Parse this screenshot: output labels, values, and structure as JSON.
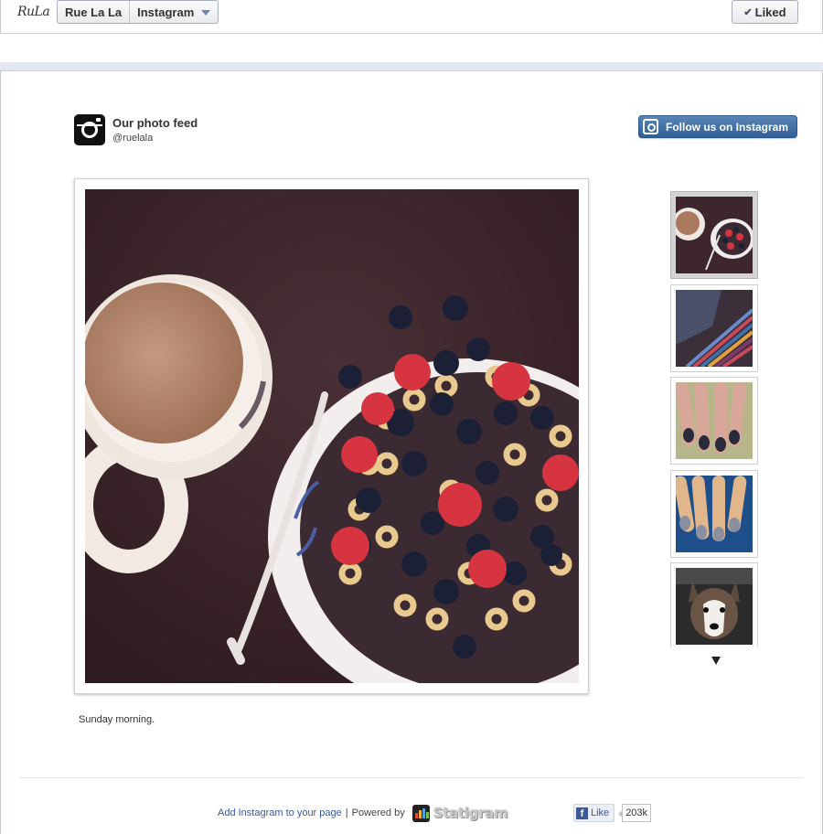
{
  "header": {
    "brand_logo_text": "Rue La La",
    "breadcrumb": {
      "page": "Rue La La",
      "app": "Instagram"
    },
    "liked_label": "Liked"
  },
  "feed": {
    "title": "Our photo feed",
    "handle": "@ruelala",
    "follow_label": "Follow us on Instagram"
  },
  "main_photo": {
    "caption": "Sunday morning."
  },
  "thumbnails": [
    {
      "subject": "coffee and cereal bowl",
      "selected": true
    },
    {
      "subject": "striped knit fabric",
      "selected": false
    },
    {
      "subject": "dark painted nails",
      "selected": false
    },
    {
      "subject": "glitter painted nails",
      "selected": false
    },
    {
      "subject": "husky dog",
      "selected": false
    }
  ],
  "footer": {
    "add_link": "Add Instagram to your page",
    "separator": "|",
    "powered_by": "Powered by",
    "statigram_name": "Statigram",
    "like_label": "Like",
    "like_count": "203k"
  },
  "colors": {
    "facebook_blue": "#3b5998",
    "follow_button": "#3f6ea3",
    "photo_background": "#3a2328"
  }
}
